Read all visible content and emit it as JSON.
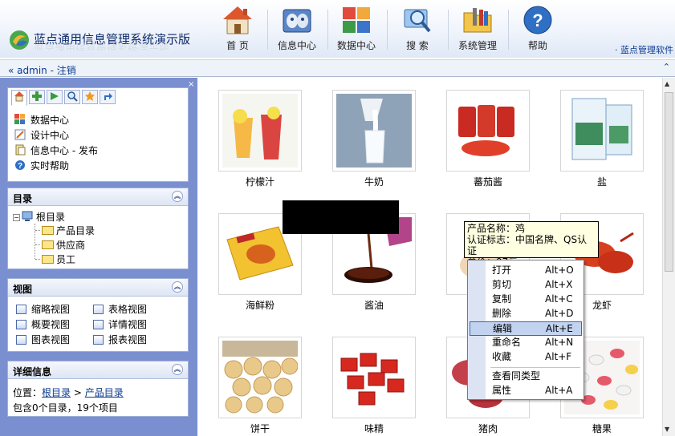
{
  "header": {
    "app_title": "蓝点通用信息管理系统演示版",
    "brand_link": "· 蓝点管理软件",
    "nav": [
      {
        "label": "首 页",
        "icon": "home-icon"
      },
      {
        "label": "信息中心",
        "icon": "info-center-icon"
      },
      {
        "label": "数据中心",
        "icon": "data-center-icon"
      },
      {
        "label": "搜 索",
        "icon": "search-icon"
      },
      {
        "label": "系统管理",
        "icon": "system-admin-icon"
      },
      {
        "label": "帮助",
        "icon": "help-icon"
      }
    ]
  },
  "userbar": {
    "user": "admin",
    "separator": " - ",
    "logout": "注销",
    "collapse_glyph": "«",
    "expand_glyph": "⌃"
  },
  "sidebar": {
    "tool_tabs": [
      "home-icon",
      "add-icon",
      "go-icon",
      "search-icon",
      "favorite-icon",
      "jump-icon"
    ],
    "links": [
      {
        "label": "数据中心",
        "icon": "data-icon"
      },
      {
        "label": "设计中心",
        "icon": "design-icon"
      },
      {
        "label": "信息中心 - 发布",
        "icon": "publish-icon"
      },
      {
        "label": "实时帮助",
        "icon": "help-icon"
      }
    ],
    "catalog": {
      "title": "目录",
      "root": "根目录",
      "children": [
        "产品目录",
        "供应商",
        "员工"
      ]
    },
    "views": {
      "title": "视图",
      "items": [
        "缩略视图",
        "表格视图",
        "概要视图",
        "详情视图",
        "图表视图",
        "报表视图"
      ]
    },
    "details": {
      "title": "详细信息",
      "location_label": "位置：",
      "path": [
        "根目录",
        "产品目录"
      ],
      "path_sep": " > ",
      "summary": "包含0个目录，19个项目"
    }
  },
  "items": [
    {
      "label": "柠檬汁",
      "icon": "juice-photo"
    },
    {
      "label": "牛奶",
      "icon": "milk-photo"
    },
    {
      "label": "蕃茄酱",
      "icon": "ketchup-photo"
    },
    {
      "label": "盐",
      "icon": "salt-photo"
    },
    {
      "label": "海鲜粉",
      "icon": "seafood-powder-photo"
    },
    {
      "label": "酱油",
      "icon": "soy-sauce-photo"
    },
    {
      "label": "",
      "icon": "chicken-photo"
    },
    {
      "label": "龙虾",
      "icon": "lobster-photo"
    },
    {
      "label": "饼干",
      "icon": "biscuit-photo"
    },
    {
      "label": "味精",
      "icon": "msg-photo"
    },
    {
      "label": "猪肉",
      "icon": "pork-photo"
    },
    {
      "label": "糖果",
      "icon": "candy-photo"
    }
  ],
  "tooltip": {
    "line1": "产品名称：鸡",
    "line2": "认证标志：中国名牌、QS认证",
    "line3": "单价：97元"
  },
  "context_menu": [
    {
      "label": "打开",
      "shortcut": "Alt+O"
    },
    {
      "label": "剪切",
      "shortcut": "Alt+X"
    },
    {
      "label": "复制",
      "shortcut": "Alt+C"
    },
    {
      "label": "删除",
      "shortcut": "Alt+D"
    },
    {
      "label": "编辑",
      "shortcut": "Alt+E",
      "highlighted": true
    },
    {
      "label": "重命名",
      "shortcut": "Alt+N"
    },
    {
      "label": "收藏",
      "shortcut": "Alt+F"
    },
    {
      "label": "查看同类型",
      "shortcut": ""
    },
    {
      "label": "属性",
      "shortcut": "Alt+A"
    }
  ],
  "colors": {
    "sidebar_bg": "#7a8fd0",
    "accent_link": "#0b3a8f",
    "menu_highlight": "#c2d3f0"
  }
}
